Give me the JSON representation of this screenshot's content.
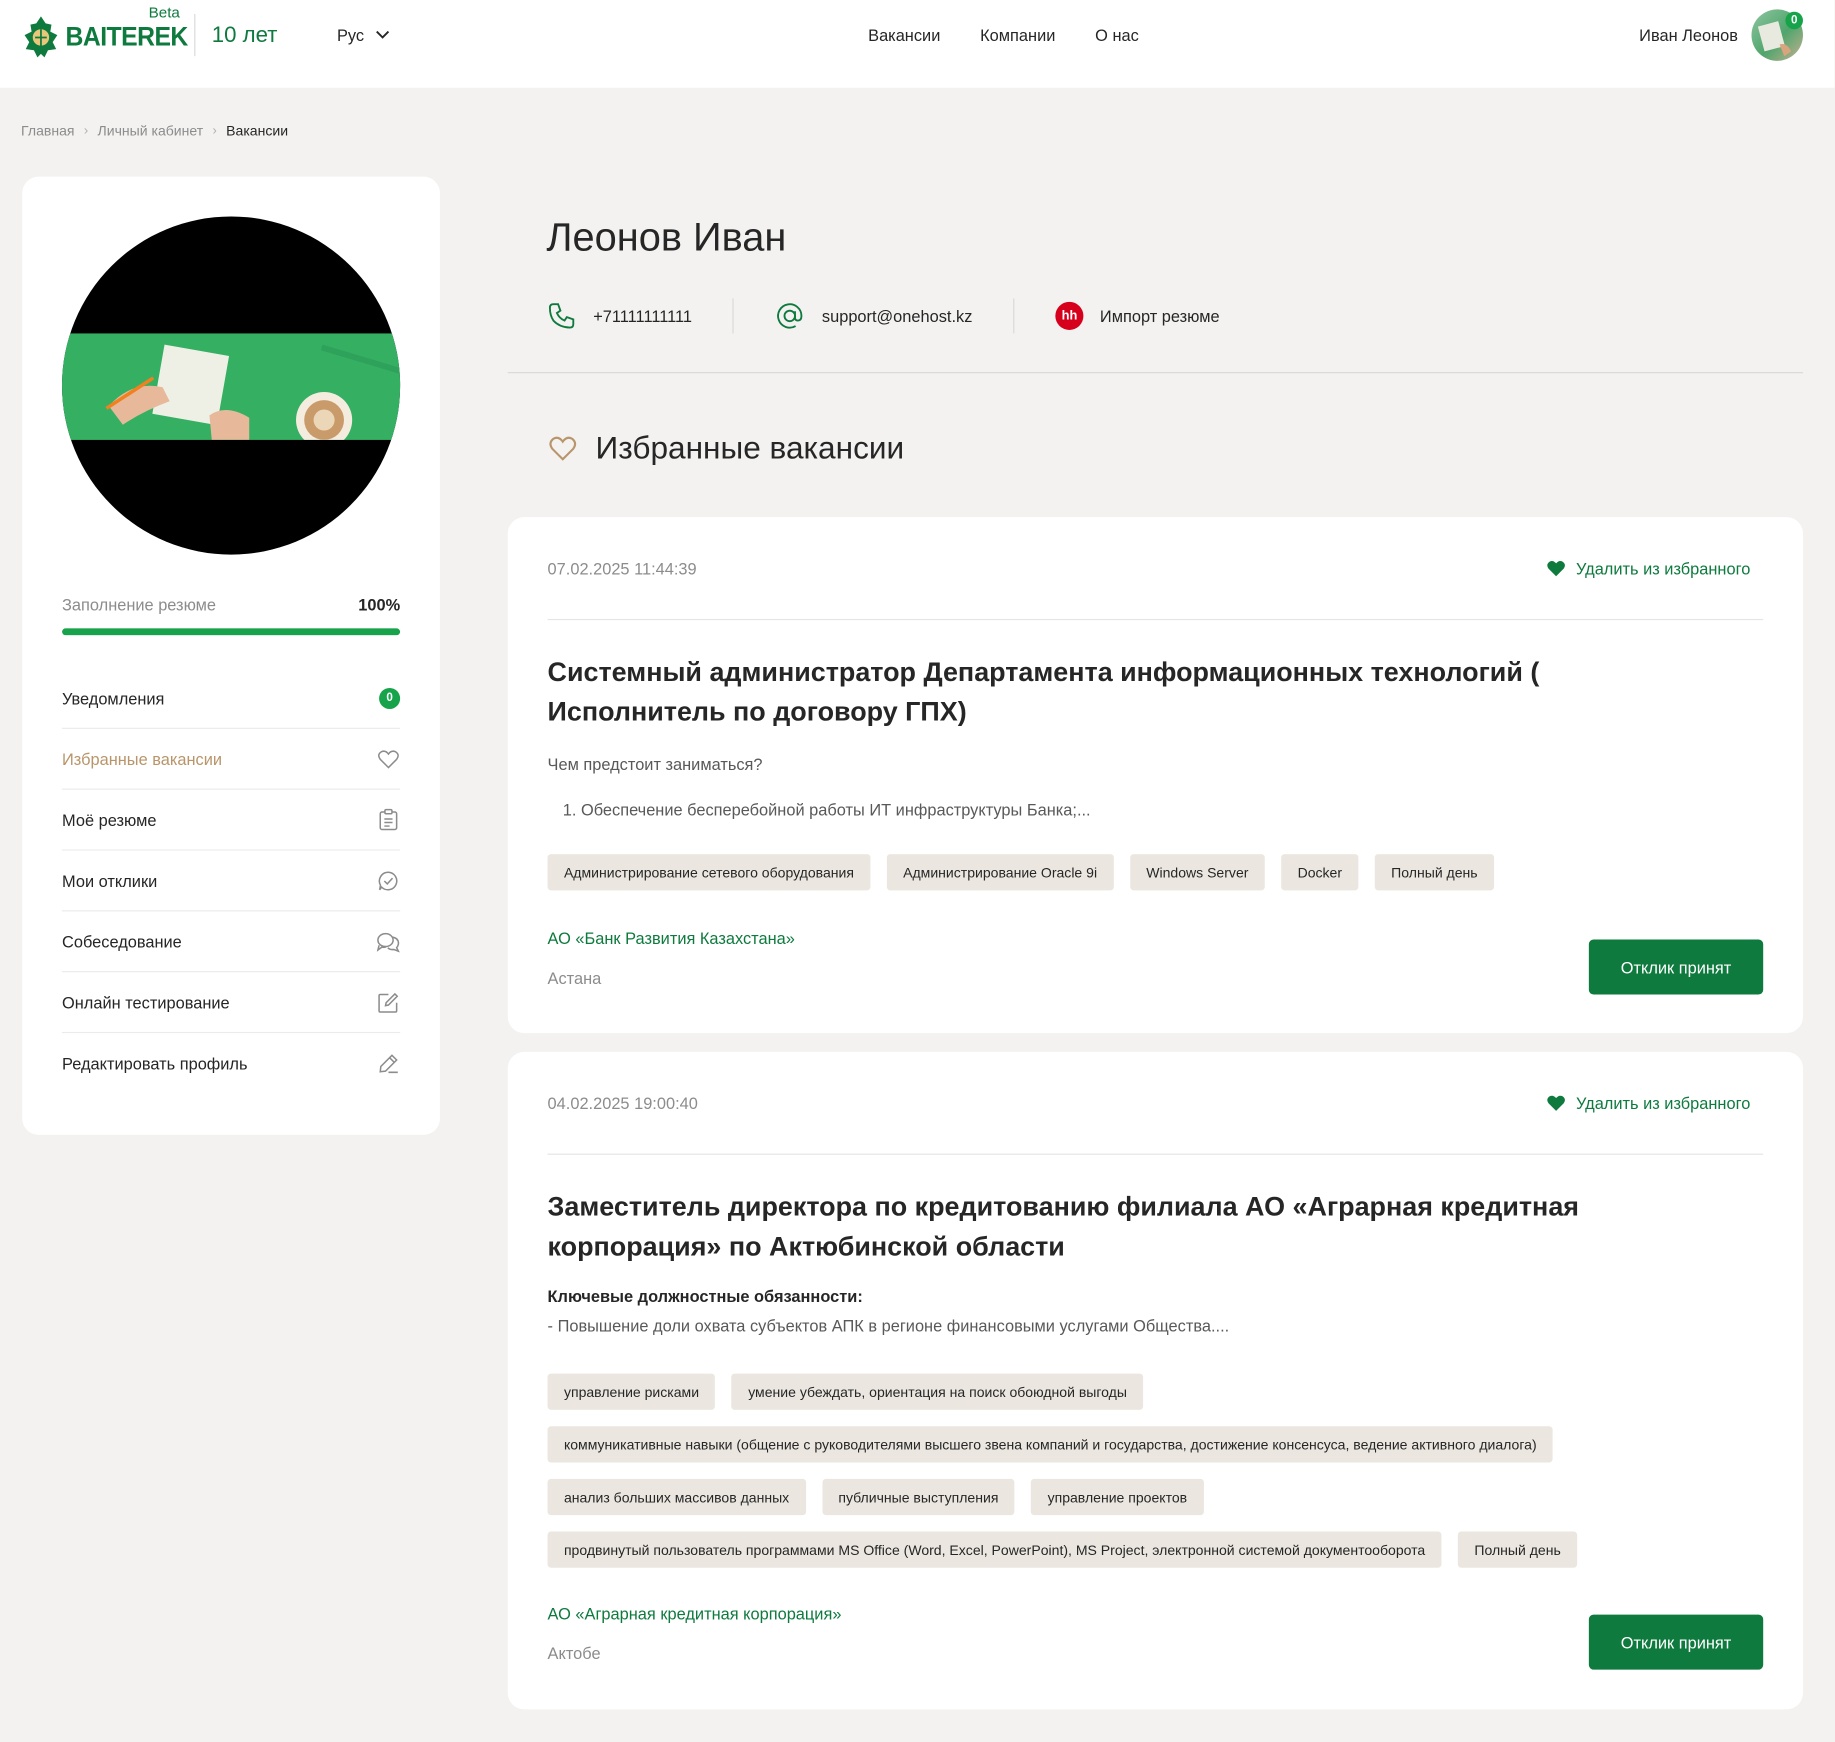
{
  "header": {
    "logo_text": "BAITEREK",
    "beta_label": "Beta",
    "years_label": "10 лет",
    "language": "Рус",
    "nav": [
      "Вакансии",
      "Компании",
      "О нас"
    ],
    "user_name": "Иван Леонов",
    "notifications_count": "0",
    "brand_color": "#0e7a3e"
  },
  "breadcrumbs": [
    "Главная",
    "Личный кабинет",
    "Вакансии"
  ],
  "sidebar": {
    "progress_label": "Заполнение резюме",
    "progress_value": "100%",
    "progress_fraction": 1.0,
    "menu": [
      {
        "label": "Уведомления",
        "icon": "badge",
        "badge": "0"
      },
      {
        "label": "Избранные вакансии",
        "icon": "heart-icon",
        "active": true
      },
      {
        "label": "Моё резюме",
        "icon": "clipboard-icon"
      },
      {
        "label": "Мои отклики",
        "icon": "chat-check-icon"
      },
      {
        "label": "Собеседование",
        "icon": "chat-bubbles-icon"
      },
      {
        "label": "Онлайн тестирование",
        "icon": "edit-square-icon"
      },
      {
        "label": "Редактировать профиль",
        "icon": "pencil-icon"
      }
    ]
  },
  "profile": {
    "name": "Леонов Иван",
    "phone": "+71111111111",
    "email": "support@onehost.kz",
    "import_label": "Импорт резюме",
    "hh_label": "hh"
  },
  "favorites": {
    "title": "Избранные вакансии",
    "cards": [
      {
        "date": "07.02.2025 11:44:39",
        "remove_label": "Удалить из избранного",
        "title": "Системный администратор Департамента информационных технологий ( Исполнитель по договору ГПХ)",
        "desc_1": "Чем предстоит заниматься?",
        "desc_2": "1. Обеспечение бесперебойной работы ИТ инфраструктуры Банка;...",
        "tags": [
          "Администрирование сетевого оборудования",
          "Администрирование Oracle 9i",
          "Windows Server",
          "Docker",
          "Полный день"
        ],
        "company": "АО «Банк Развития Казахстана»",
        "city": "Астана",
        "button": "Отклик принят"
      },
      {
        "date": "04.02.2025 19:00:40",
        "remove_label": "Удалить из избранного",
        "title": "Заместитель директора по кредитованию филиала АО «Аграрная кредитная корпорация» по Актюбинской области",
        "desc_1": "Ключевые должностные обязанности:",
        "desc_2": "- Повышение доли охвата субъектов АПК в регионе финансовыми услугами Общества....",
        "tags": [
          "управление рисками",
          "умение убеждать, ориентация на поиск обоюдной выгоды",
          "коммуникативные навыки (общение с руководителями высшего звена компаний и государства, достижение консенсуса, ведение активного диалога)",
          "анализ больших массивов данных",
          "публичные выступления",
          "управление проектов",
          "продвинутый пользователь программами MS Office (Word, Excel, PowerPoint), MS Project, электронной системой документооборота",
          "Полный день"
        ],
        "company": "АО «Аграрная кредитная корпорация»",
        "city": "Актобе",
        "button": "Отклик принят"
      }
    ]
  }
}
